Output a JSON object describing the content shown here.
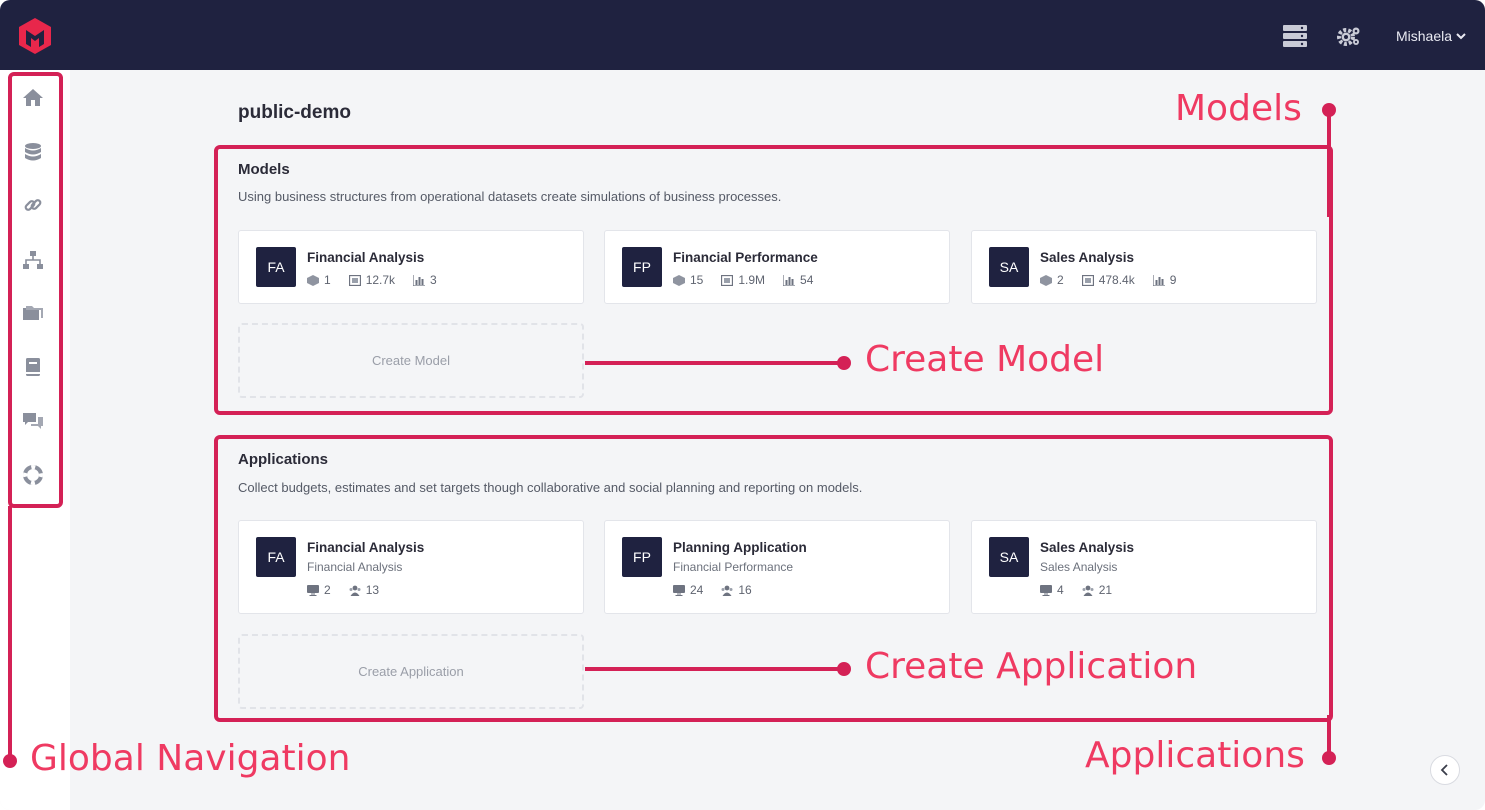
{
  "header": {
    "user_name": "Mishaela",
    "icons": [
      "server-icon",
      "settings-gears-icon",
      "chevron-down-icon"
    ]
  },
  "sidebar": {
    "items": [
      {
        "name": "home",
        "icon": "home-icon"
      },
      {
        "name": "data",
        "icon": "database-icon"
      },
      {
        "name": "links",
        "icon": "link-icon"
      },
      {
        "name": "structures",
        "icon": "hierarchy-icon"
      },
      {
        "name": "files",
        "icon": "folder-icon"
      },
      {
        "name": "docs",
        "icon": "book-icon"
      },
      {
        "name": "chat",
        "icon": "chat-icon"
      },
      {
        "name": "support",
        "icon": "lifebuoy-icon"
      }
    ]
  },
  "page": {
    "title": "public-demo"
  },
  "models": {
    "title": "Models",
    "description": "Using business structures from operational datasets create simulations of business processes.",
    "cards": [
      {
        "initials": "FA",
        "name": "Financial Analysis",
        "cubes": "1",
        "records": "12.7k",
        "measures": "3"
      },
      {
        "initials": "FP",
        "name": "Financial Performance",
        "cubes": "15",
        "records": "1.9M",
        "measures": "54"
      },
      {
        "initials": "SA",
        "name": "Sales Analysis",
        "cubes": "2",
        "records": "478.4k",
        "measures": "9"
      }
    ],
    "create_label": "Create Model"
  },
  "applications": {
    "title": "Applications",
    "description": "Collect budgets, estimates and set targets though collaborative and social planning and reporting on models.",
    "cards": [
      {
        "initials": "FA",
        "name": "Financial Analysis",
        "model": "Financial Analysis",
        "screens": "2",
        "users": "13"
      },
      {
        "initials": "FP",
        "name": "Planning Application",
        "model": "Financial Performance",
        "screens": "24",
        "users": "16"
      },
      {
        "initials": "SA",
        "name": "Sales Analysis",
        "model": "Sales Analysis",
        "screens": "4",
        "users": "21"
      }
    ],
    "create_label": "Create Application"
  },
  "annotations": {
    "models": "Models",
    "create_model": "Create Model",
    "create_application": "Create Application",
    "applications": "Applications",
    "global_navigation": "Global Navigation"
  },
  "colors": {
    "topbar": "#1f2240",
    "brand_red": "#e8274b",
    "annotation": "#d42156",
    "annotation_text": "#ef3a62"
  }
}
